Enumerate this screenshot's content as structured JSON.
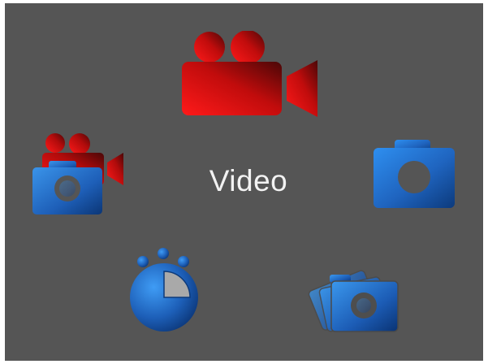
{
  "mode_dial": {
    "selected_label": "Video",
    "selected_mode_icon": "video-camera-icon",
    "modes": [
      {
        "name": "video",
        "icon": "video-camera-icon",
        "selected": true
      },
      {
        "name": "photo",
        "icon": "photo-camera-icon",
        "selected": false
      },
      {
        "name": "burst",
        "icon": "burst-photos-icon",
        "selected": false
      },
      {
        "name": "time-lapse",
        "icon": "time-lapse-timer-icon",
        "selected": false
      },
      {
        "name": "video-plus-photo",
        "icon": "video-photo-combo-icon",
        "selected": false
      }
    ]
  },
  "colors": {
    "background": "#555555",
    "selected_red": "#ff0000",
    "selected_dark_red": "#5a0606",
    "mode_blue": "#2f86e0",
    "mode_dark_blue": "#0d3a7a",
    "label_text": "#f2f2f2"
  }
}
